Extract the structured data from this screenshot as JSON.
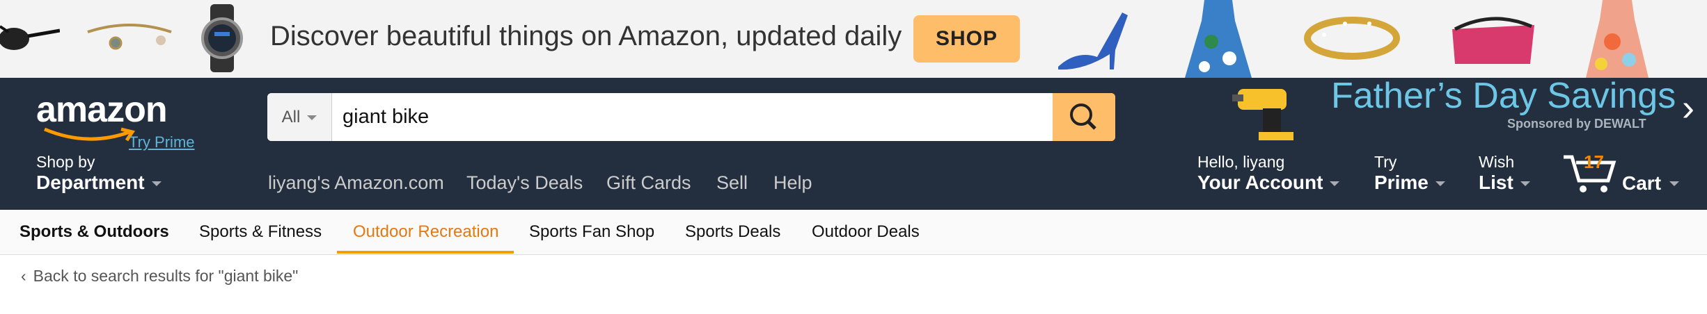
{
  "promo": {
    "text": "Discover beautiful things on Amazon, updated daily",
    "shop_label": "SHOP"
  },
  "header": {
    "logo": "amazon",
    "try_prime": "Try Prime",
    "search": {
      "category": "All",
      "value": "giant bike"
    },
    "ad": {
      "title": "Father’s Day Savings",
      "sponsor": "Sponsored by DEWALT"
    },
    "shop_by": "Shop by",
    "department": "Department",
    "links": [
      "liyang's Amazon.com",
      "Today's Deals",
      "Gift Cards",
      "Sell",
      "Help"
    ],
    "account": {
      "hello": "Hello, liyang",
      "label": "Your Account"
    },
    "prime": {
      "try": "Try",
      "label": "Prime"
    },
    "wish": {
      "top": "Wish",
      "label": "List"
    },
    "cart": {
      "count": "17",
      "label": "Cart"
    }
  },
  "subnav": {
    "items": [
      "Sports & Outdoors",
      "Sports & Fitness",
      "Outdoor Recreation",
      "Sports Fan Shop",
      "Sports Deals",
      "Outdoor Deals"
    ],
    "active": "Outdoor Recreation"
  },
  "back_link": "Back to search results for \"giant bike\"",
  "colors": {
    "nav_bg": "#232f3e",
    "accent": "#febd69",
    "active_tab": "#e47911"
  }
}
